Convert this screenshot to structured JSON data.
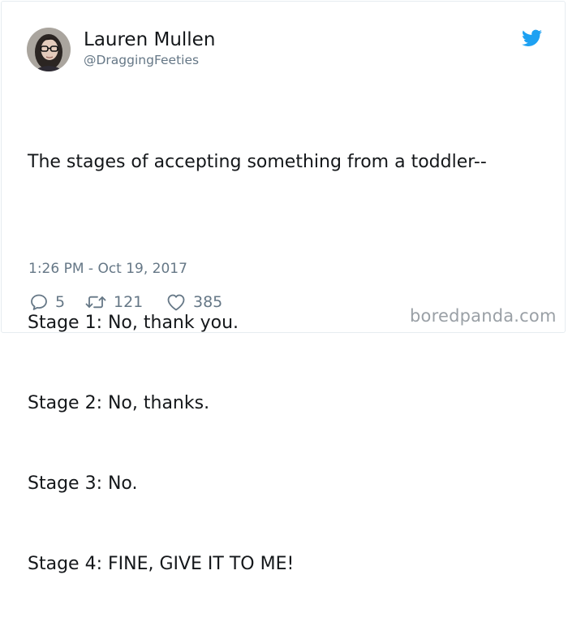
{
  "user": {
    "display_name": "Lauren Mullen",
    "handle": "@DraggingFeeties"
  },
  "tweet": {
    "lines": [
      "The stages of accepting something from a toddler--",
      "",
      "Stage 1: No, thank you.",
      "Stage 2: No, thanks.",
      "Stage 3: No.",
      "Stage 4: FINE, GIVE IT TO ME!"
    ],
    "timestamp": "1:26 PM - Oct 19, 2017"
  },
  "actions": {
    "replies": "5",
    "retweets": "121",
    "likes": "385"
  },
  "icons": {
    "brand": "twitter-bird-icon",
    "reply": "reply-icon",
    "retweet": "retweet-icon",
    "like": "heart-icon"
  },
  "colors": {
    "twitter_blue": "#1da1f2",
    "text": "#14171a",
    "muted": "#657786",
    "watermark": "#9aa0a6"
  },
  "watermark": "boredpanda.com"
}
